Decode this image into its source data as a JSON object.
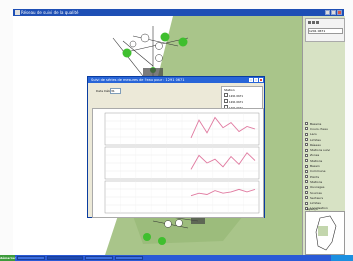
{
  "window": {
    "title": "Réseau de suivi de la qualité"
  },
  "dialog": {
    "title": "Suivi de séries de mesures de l'eau pour : 1291 0671",
    "date_label": "Date Début",
    "date_value": "31",
    "legend_header": "Station",
    "legend_items": [
      "1291 0671",
      "1291 0671",
      "1291 0671"
    ]
  },
  "right_panel": {
    "layers": [
      "Bassins",
      "Cours d'eau",
      "Lacs",
      "Limites",
      "Réseau",
      "Stations suivi",
      "Zones",
      "Stations",
      "Bassin",
      "Commune",
      "Points",
      "Stations",
      "Ouvrages",
      "Sources",
      "Secteurs",
      "Limites",
      "Localisation"
    ],
    "selector_value": "1291 0671",
    "preview_label": "Aperçu"
  },
  "taskbar": {
    "start_label": "démarrer"
  },
  "colors": {
    "series_color": "#e07aa0",
    "field_green": "#a9c58a",
    "marker_green": "#3fbf2e",
    "titlebar_blue": "#1e4fb5"
  },
  "chart_data": [
    {
      "type": "line",
      "series": [
        {
          "values": [
            14,
            28,
            18,
            30,
            22,
            26,
            19,
            23,
            21
          ]
        }
      ]
    },
    {
      "type": "line",
      "series": [
        {
          "values": [
            16,
            27,
            21,
            24,
            18,
            26,
            20,
            29,
            23
          ]
        }
      ]
    },
    {
      "type": "line",
      "series": [
        {
          "values": [
            22,
            24,
            23,
            26,
            24,
            25,
            27,
            25,
            27
          ]
        }
      ]
    }
  ]
}
